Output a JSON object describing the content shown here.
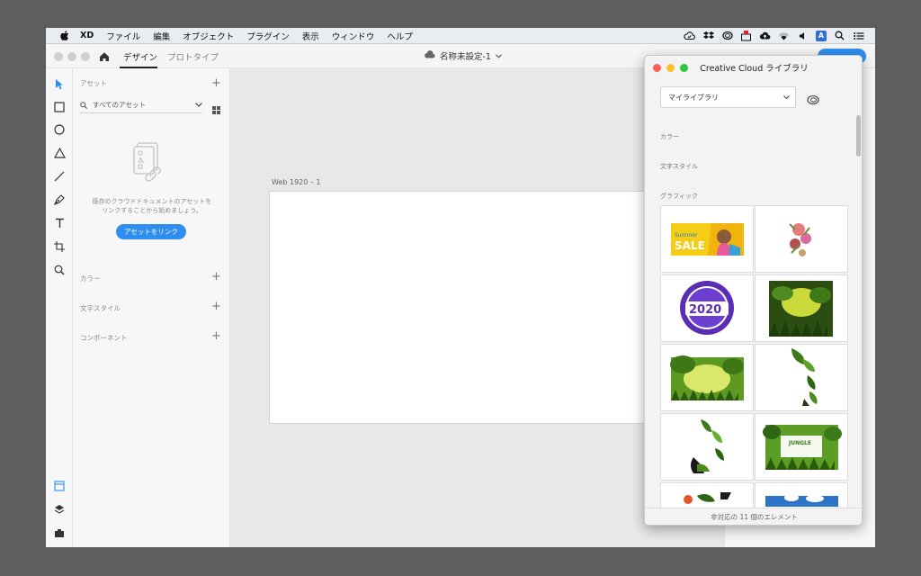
{
  "menubar": {
    "app_name": "XD",
    "items": [
      "ファイル",
      "編集",
      "オブジェクト",
      "プラグイン",
      "表示",
      "ウィンドウ",
      "ヘルプ"
    ],
    "status_icons": [
      "creative-cloud-sync-icon",
      "dropbox-icon",
      "cc-app-icon",
      "mail-icon",
      "cloud-upload-icon",
      "wifi-icon",
      "volume-icon",
      "input-method-icon",
      "spotlight-icon",
      "control-center-icon"
    ],
    "input_method_label": "A"
  },
  "window": {
    "tabs": [
      "デザイン",
      "プロトタイプ"
    ],
    "active_tab": "デザイン",
    "document_title": "名称未設定-1"
  },
  "assets_panel": {
    "header": "アセット",
    "filter_value": "すべてのアセット",
    "empty_message": "既存のクラウドドキュメントのアセットをリンクすることから始めましょう。",
    "link_button": "アセットをリンク",
    "sections": [
      "カラー",
      "文字スタイル",
      "コンポーネント"
    ]
  },
  "canvas": {
    "artboard_label": "Web 1920 – 1"
  },
  "cc_library": {
    "title": "Creative Cloud ライブラリ",
    "library_select": "マイライブラリ",
    "sections": [
      "カラー",
      "文字スタイル",
      "グラフィック"
    ],
    "footer": "非対応の 11 個のエレメント",
    "thumb_text": {
      "sale_small": "Summer",
      "sale": "SALE",
      "year": "2020",
      "jungle": "JUNGLE"
    }
  },
  "colors": {
    "accent": "#2d8ef0",
    "tool_active": "#2d8ef0"
  }
}
